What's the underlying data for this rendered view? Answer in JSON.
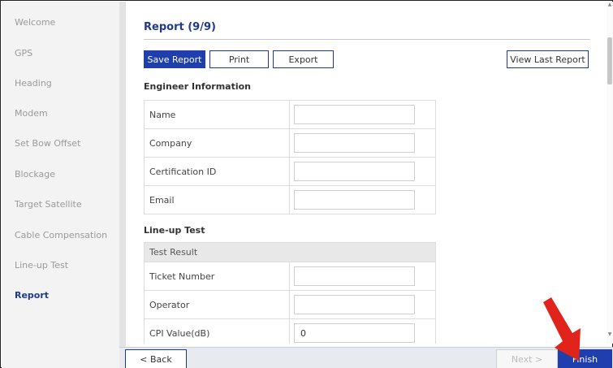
{
  "sidebar": {
    "items": [
      {
        "label": "Welcome"
      },
      {
        "label": "GPS"
      },
      {
        "label": "Heading"
      },
      {
        "label": "Modem"
      },
      {
        "label": "Set Bow Offset"
      },
      {
        "label": "Blockage"
      },
      {
        "label": "Target Satellite"
      },
      {
        "label": "Cable Compensation"
      },
      {
        "label": "Line-up Test"
      },
      {
        "label": "Report"
      }
    ],
    "active_index": 9
  },
  "main": {
    "title": "Report (9/9)",
    "toolbar": {
      "save": "Save Report",
      "print": "Print",
      "export": "Export",
      "view_last": "View Last Report"
    },
    "engineer_section": {
      "heading": "Engineer Information",
      "rows": [
        {
          "label": "Name",
          "value": ""
        },
        {
          "label": "Company",
          "value": ""
        },
        {
          "label": "Certification ID",
          "value": ""
        },
        {
          "label": "Email",
          "value": ""
        }
      ]
    },
    "lineup_section": {
      "heading": "Line-up Test",
      "group": "Test Result",
      "rows": [
        {
          "label": "Ticket Number",
          "value": ""
        },
        {
          "label": "Operator",
          "value": ""
        },
        {
          "label": "CPI Value(dB)",
          "value": "0"
        }
      ]
    }
  },
  "footer": {
    "back": "< Back",
    "next": "Next >",
    "finish": "Finish"
  },
  "colors": {
    "accent": "#1f3fae",
    "title": "#1f3a8a",
    "annotation_arrow": "#e0241b"
  }
}
